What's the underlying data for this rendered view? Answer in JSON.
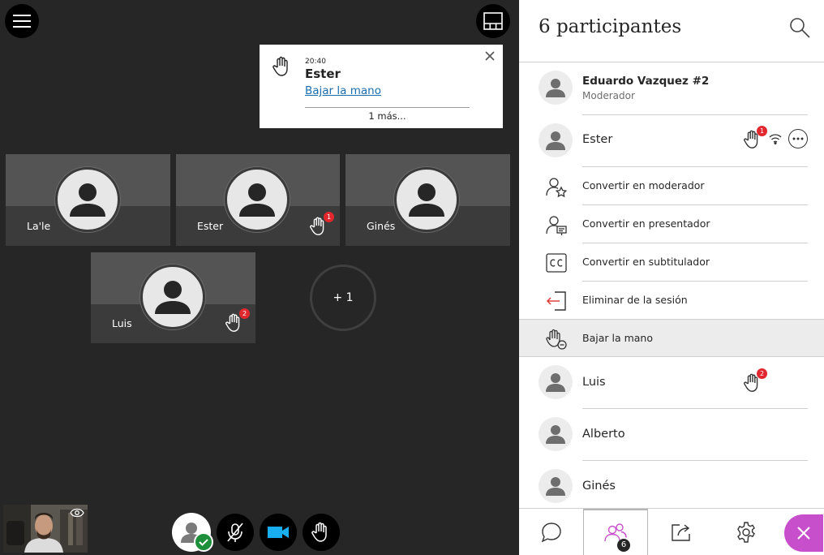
{
  "notification": {
    "time": "20:40",
    "name": "Ester",
    "action": "Bajar la mano",
    "more": "1 más..."
  },
  "tiles": [
    {
      "name": "La'le"
    },
    {
      "name": "Ester",
      "hand_count": "1"
    },
    {
      "name": "Ginés"
    },
    {
      "name": "Luis",
      "hand_count": "2"
    }
  ],
  "overflow_tile": {
    "label": "+ 1"
  },
  "panel": {
    "title": "6 participantes",
    "participants": [
      {
        "name": "Eduardo Vazquez #2",
        "role": "Moderador"
      },
      {
        "name": "Ester",
        "hand_count": "1"
      },
      {
        "name": "Luis",
        "hand_count": "2"
      },
      {
        "name": "Alberto"
      },
      {
        "name": "Ginés"
      }
    ],
    "options": [
      {
        "label": "Convertir en moderador",
        "icon": "moderator-icon"
      },
      {
        "label": "Convertir en presentador",
        "icon": "presenter-icon"
      },
      {
        "label": "Convertir en subtitulador",
        "icon": "captioner-icon"
      },
      {
        "label": "Eliminar de la sesión",
        "icon": "remove-icon"
      },
      {
        "label": "Bajar la mano",
        "icon": "lower-hand-icon"
      }
    ],
    "tabs": {
      "participants_count": "6"
    }
  },
  "colors": {
    "stage_bg": "#262626",
    "accent": "#c84fcb",
    "link": "#1a6dae",
    "camera_active": "#18aef0",
    "badge": "#e0282e",
    "status_ok": "#1e8f3a"
  }
}
